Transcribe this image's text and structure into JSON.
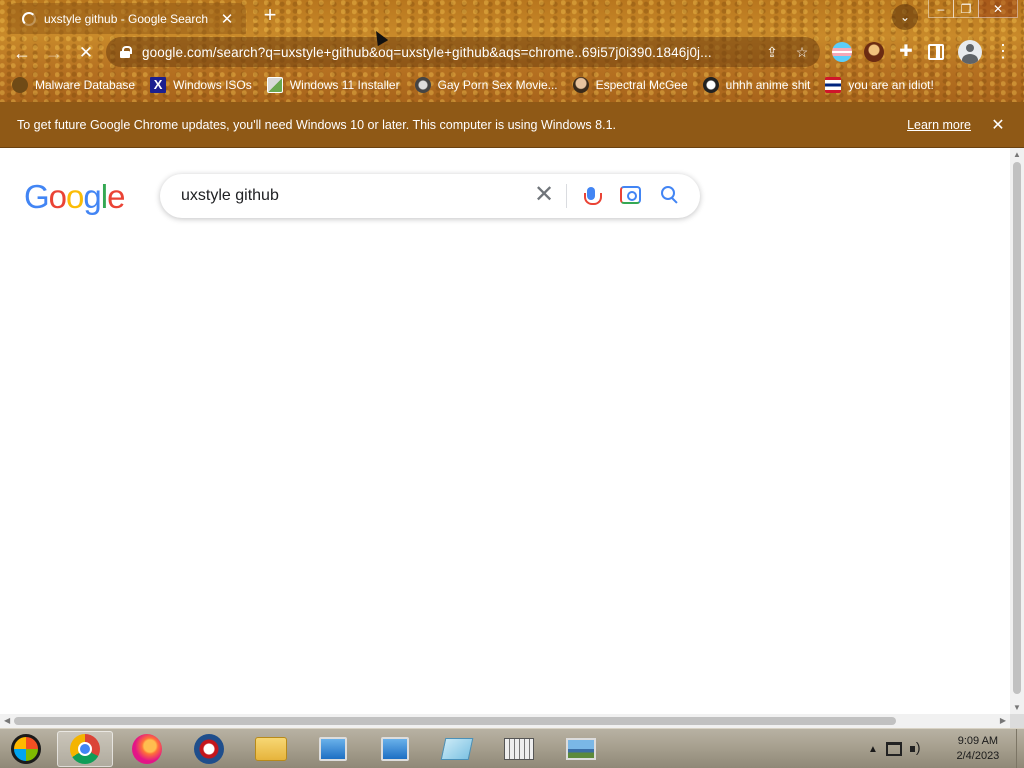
{
  "browser": {
    "tab": {
      "title": "uxstyle github - Google Search",
      "close_label": "✕",
      "new_tab_label": "+"
    },
    "tab_search_label": "⌄",
    "window_controls": {
      "minimize": "–",
      "maximize": "❐",
      "close": "✕"
    },
    "nav": {
      "back": "←",
      "forward": "→",
      "stop": "✕"
    },
    "omnibox": {
      "url": "google.com/search?q=uxstyle+github&oq=uxstyle+github&aqs=chrome..69i57j0i390.1846j0j..."
    },
    "bookmarks": [
      {
        "label": "Malware Database",
        "icon": "malware-icon"
      },
      {
        "label": "Windows ISOs",
        "icon": "x-icon"
      },
      {
        "label": "Windows 11 Installer",
        "icon": "installer-icon"
      },
      {
        "label": "Gay Porn Sex Movie...",
        "icon": "disc-icon"
      },
      {
        "label": "Espectral McGee",
        "icon": "face-icon"
      },
      {
        "label": "uhhh anime shit",
        "icon": "anime-icon"
      },
      {
        "label": "you are an idiot!",
        "icon": "flag-icon"
      }
    ]
  },
  "infobar": {
    "message": "To get future Google Chrome updates, you'll need Windows 10 or later. This computer is using Windows 8.1.",
    "learn_more": "Learn more",
    "close_label": "✕"
  },
  "page": {
    "logo_letters": [
      "G",
      "o",
      "o",
      "g",
      "l",
      "e"
    ],
    "search": {
      "value": "uxstyle github",
      "clear_label": "✕"
    }
  },
  "taskbar": {
    "apps": [
      "start",
      "chrome",
      "firefox",
      "opera",
      "file-explorer",
      "remote-desktop-1",
      "remote-desktop-2",
      "notepad",
      "store",
      "photos"
    ],
    "tray": {
      "time": "9:09 AM",
      "date": "2/4/2023"
    }
  },
  "colors": {
    "infobar": "#8f5916",
    "theme": "#b8761e",
    "google_blue": "#4285f4"
  }
}
